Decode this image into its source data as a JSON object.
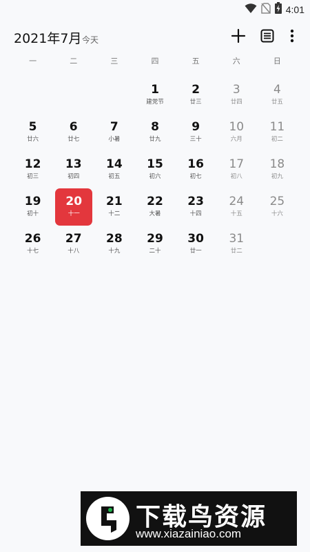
{
  "status_bar": {
    "time": "4:01",
    "icons": [
      "wifi-icon",
      "no-sim-icon",
      "battery-charging-icon"
    ]
  },
  "header": {
    "month_title": "2021年7月",
    "today_label": "今天",
    "icons": [
      "add-icon",
      "list-icon",
      "more-vert-icon"
    ]
  },
  "weekdays": [
    "一",
    "二",
    "三",
    "四",
    "五",
    "六",
    "日"
  ],
  "calendar": {
    "leading_blank_days": 3,
    "selected_day": "20",
    "accent_color": "#e3373d",
    "days": [
      {
        "day": "1",
        "lunar": "建党节"
      },
      {
        "day": "2",
        "lunar": "廿三"
      },
      {
        "day": "3",
        "lunar": "廿四"
      },
      {
        "day": "4",
        "lunar": "廿五"
      },
      {
        "day": "5",
        "lunar": "廿六"
      },
      {
        "day": "6",
        "lunar": "廿七"
      },
      {
        "day": "7",
        "lunar": "小暑"
      },
      {
        "day": "8",
        "lunar": "廿九"
      },
      {
        "day": "9",
        "lunar": "三十"
      },
      {
        "day": "10",
        "lunar": "六月"
      },
      {
        "day": "11",
        "lunar": "初二"
      },
      {
        "day": "12",
        "lunar": "初三"
      },
      {
        "day": "13",
        "lunar": "初四"
      },
      {
        "day": "14",
        "lunar": "初五"
      },
      {
        "day": "15",
        "lunar": "初六"
      },
      {
        "day": "16",
        "lunar": "初七"
      },
      {
        "day": "17",
        "lunar": "初八"
      },
      {
        "day": "18",
        "lunar": "初九"
      },
      {
        "day": "19",
        "lunar": "初十"
      },
      {
        "day": "20",
        "lunar": "十一"
      },
      {
        "day": "21",
        "lunar": "十二"
      },
      {
        "day": "22",
        "lunar": "大暑"
      },
      {
        "day": "23",
        "lunar": "十四"
      },
      {
        "day": "24",
        "lunar": "十五"
      },
      {
        "day": "25",
        "lunar": "十六"
      },
      {
        "day": "26",
        "lunar": "十七"
      },
      {
        "day": "27",
        "lunar": "十八"
      },
      {
        "day": "28",
        "lunar": "十九"
      },
      {
        "day": "29",
        "lunar": "二十"
      },
      {
        "day": "30",
        "lunar": "廿一"
      },
      {
        "day": "31",
        "lunar": "廿二"
      }
    ]
  },
  "watermark": {
    "title": "下载鸟资源",
    "url": "www.xiazainiao.com"
  }
}
